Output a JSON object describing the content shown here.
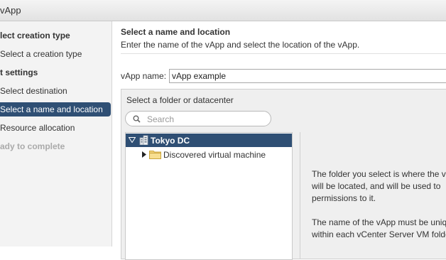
{
  "window": {
    "title": "vApp"
  },
  "nav": {
    "items": [
      {
        "label": "lect creation type"
      },
      {
        "label": "Select a creation type"
      },
      {
        "label": "t settings"
      },
      {
        "label": "Select destination"
      },
      {
        "label": "Select a name and location"
      },
      {
        "label": "Resource allocation"
      },
      {
        "label": "ady to complete"
      }
    ]
  },
  "main": {
    "title": "Select a name and location",
    "description": "Enter the name of the vApp and select the location of the vApp.",
    "name_label": "vApp name:",
    "name_value": "vApp example",
    "folder_heading": "Select a folder or datacenter",
    "search_placeholder": "Search",
    "tree": [
      {
        "label": "Tokyo DC",
        "icon": "datacenter-icon"
      },
      {
        "label": "Discovered virtual machine",
        "icon": "folder-icon"
      }
    ],
    "info": [
      "The folder you select is where the v",
      "will be located, and will be used to",
      "permissions to it.",
      "The name of the vApp must be uniq",
      "within each vCenter Server VM folde"
    ]
  },
  "colors": {
    "accent": "#2f4f74",
    "nav_bg": "#f3f3f3",
    "panel_bg": "#efefef",
    "folder": "#f2d27a"
  }
}
